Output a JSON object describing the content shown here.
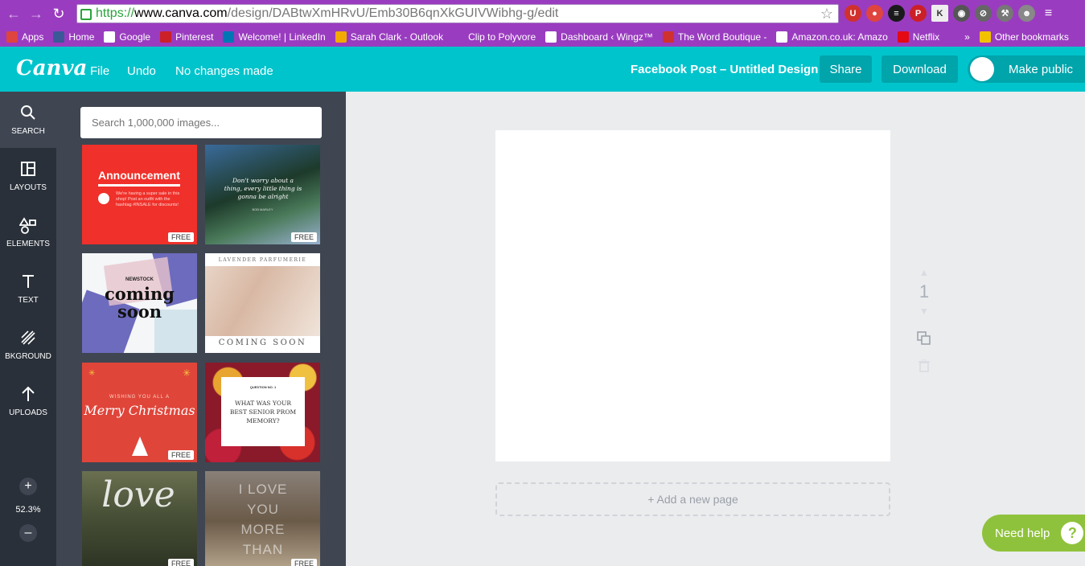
{
  "browser": {
    "url_scheme": "https://",
    "url_host": "www.canva.com",
    "url_path": "/design/DABtwXmHRvU/Emb30B6qnXkGUIVWibhg-g/edit",
    "bookmarks": [
      {
        "label": "Apps",
        "icon": "apps-grid-icon",
        "color": "#e0443e"
      },
      {
        "label": "Home",
        "icon": "facebook-icon",
        "color": "#3b5998"
      },
      {
        "label": "Google",
        "icon": "google-icon",
        "color": "#ffffff"
      },
      {
        "label": "Pinterest",
        "icon": "pinterest-icon",
        "color": "#cb2027"
      },
      {
        "label": "Welcome! | LinkedIn",
        "icon": "linkedin-icon",
        "color": "#0077b5"
      },
      {
        "label": "Sarah Clark - Outlook",
        "icon": "outlook-icon",
        "color": "#f2a900"
      },
      {
        "label": "Clip to Polyvore",
        "icon": "bookmark-icon",
        "color": "#9a3cc0"
      },
      {
        "label": "Dashboard ‹ Wingz™",
        "icon": "wordpress-icon",
        "color": "#ffffff"
      },
      {
        "label": "The Word Boutique -",
        "icon": "bookmark-icon",
        "color": "#d0312d"
      },
      {
        "label": "Amazon.co.uk: Amazo",
        "icon": "amazon-icon",
        "color": "#ffffff"
      },
      {
        "label": "Netflix",
        "icon": "netflix-icon",
        "color": "#e50914"
      },
      {
        "label": "»",
        "icon": "more-bookmarks-icon",
        "color": "#9a3cc0"
      },
      {
        "label": "Other bookmarks",
        "icon": "folder-icon",
        "color": "#f2c200"
      }
    ]
  },
  "topbar": {
    "logo": "Canva",
    "file": "File",
    "undo": "Undo",
    "status": "No changes made",
    "doc_title": "Facebook Post – Untitled Design",
    "share": "Share",
    "download": "Download",
    "make_public": "Make public",
    "accent": "#00c4cc"
  },
  "leftnav": {
    "items": [
      {
        "label": "SEARCH",
        "icon": "search-icon"
      },
      {
        "label": "LAYOUTS",
        "icon": "layouts-icon"
      },
      {
        "label": "ELEMENTS",
        "icon": "elements-icon"
      },
      {
        "label": "TEXT",
        "icon": "text-icon"
      },
      {
        "label": "BKGROUND",
        "icon": "background-icon"
      },
      {
        "label": "UPLOADS",
        "icon": "upload-icon"
      }
    ],
    "zoom_in": "+",
    "zoom_value": "52.3%",
    "zoom_out": "–"
  },
  "panel": {
    "search_placeholder": "Search 1,000,000 images...",
    "free_badge": "FREE",
    "tiles": [
      {
        "title": "Announcement",
        "body": "We're having a super sale in this shop! Post an outfit with the hashtag #INSALE for discounts!",
        "free": true
      },
      {
        "title": "Don't worry about a thing, every little thing is gonna be alright",
        "sub": "BOB MARLEY",
        "free": true
      },
      {
        "title": "coming soon",
        "sub": "NEWSTOCK",
        "free": false
      },
      {
        "title": "COMING SOON",
        "sub": "LAVENDER PARFUMERIE",
        "free": false
      },
      {
        "title": "Merry Christmas",
        "sub": "WISHING YOU ALL A",
        "free": true
      },
      {
        "title": "WHAT WAS YOUR BEST SENIOR PROM MEMORY?",
        "sub": "QUESTION NO. 1",
        "free": false
      },
      {
        "title": "love",
        "free": true
      },
      {
        "title": "I LOVE YOU MORE THAN",
        "free": true
      }
    ]
  },
  "editor": {
    "page_number": "1",
    "add_page": "+ Add a new page",
    "help": "Need help",
    "help_icon": "?"
  }
}
